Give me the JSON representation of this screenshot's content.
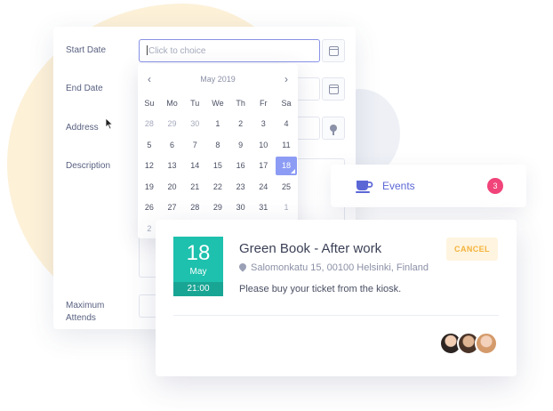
{
  "form": {
    "start_date": {
      "label": "Start Date",
      "placeholder": "Click to choice"
    },
    "end_date": {
      "label": "End Date"
    },
    "address": {
      "label": "Address"
    },
    "description": {
      "label": "Description"
    },
    "max_attends": {
      "label": "Maximum Attends"
    }
  },
  "calendar": {
    "month_label": "May 2019",
    "prev": "‹",
    "next": "›",
    "weekdays": [
      "Su",
      "Mo",
      "Tu",
      "We",
      "Th",
      "Fr",
      "Sa"
    ],
    "weeks": [
      [
        "28",
        "29",
        "30",
        "1",
        "2",
        "3",
        "4"
      ],
      [
        "5",
        "6",
        "7",
        "8",
        "9",
        "10",
        "11"
      ],
      [
        "12",
        "13",
        "14",
        "15",
        "16",
        "17",
        "18"
      ],
      [
        "19",
        "20",
        "21",
        "22",
        "23",
        "24",
        "25"
      ],
      [
        "26",
        "27",
        "28",
        "29",
        "30",
        "31",
        "1"
      ],
      [
        "2"
      ]
    ],
    "muted": [
      [
        0,
        0
      ],
      [
        0,
        1
      ],
      [
        0,
        2
      ],
      [
        4,
        6
      ],
      [
        5,
        0
      ]
    ],
    "selected": [
      2,
      6
    ],
    "selected_color": "#8c9cf4"
  },
  "events_widget": {
    "label": "Events",
    "count": "3",
    "icon": "coffee-cup-icon",
    "accent": "#5c67d6",
    "badge_color": "#f0447a"
  },
  "event_card": {
    "day": "18",
    "month": "May",
    "time": "21:00",
    "title": "Green Book - After work",
    "location": "Salomonkatu 15, 00100 Helsinki, Finland",
    "note": "Please buy your ticket from the kiosk.",
    "cancel_label": "CANCEL",
    "tile_color": "#1dc1ad"
  }
}
